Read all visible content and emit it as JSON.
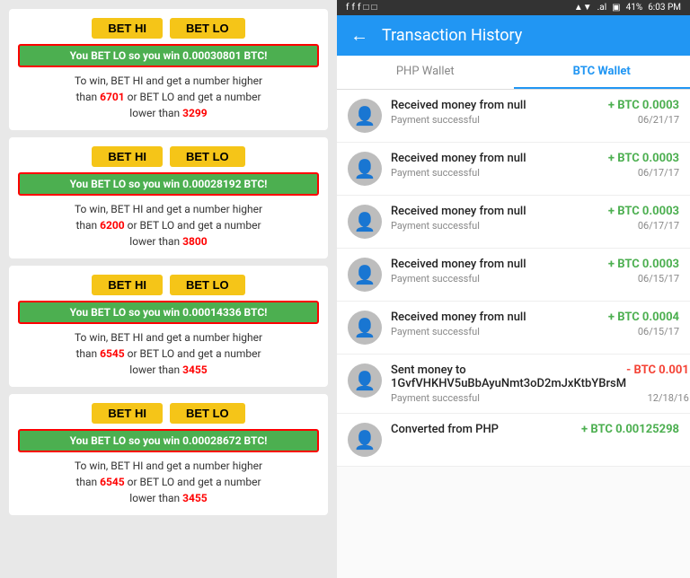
{
  "left": {
    "cards": [
      {
        "id": "card1",
        "bet_hi": "BET HI",
        "bet_lo": "BET LO",
        "win_msg": "You BET LO so you win 0.00030801 BTC!",
        "info_line1": "To win, BET HI and get a number higher",
        "info_line2": "than",
        "num_hi": "6701",
        "info_line3": "or BET LO and get a number",
        "info_line4": "lower than",
        "num_lo": "3299"
      },
      {
        "id": "card2",
        "bet_hi": "BET HI",
        "bet_lo": "BET LO",
        "win_msg": "You BET LO so you win 0.00028192 BTC!",
        "info_line1": "To win, BET HI and get a number higher",
        "info_line2": "than",
        "num_hi": "6200",
        "info_line3": "or BET LO and get a number",
        "info_line4": "lower than",
        "num_lo": "3800"
      },
      {
        "id": "card3",
        "bet_hi": "BET HI",
        "bet_lo": "BET LO",
        "win_msg": "You BET LO so you win 0.00014336 BTC!",
        "info_line1": "To win, BET HI and get a number higher",
        "info_line2": "than",
        "num_hi": "6545",
        "info_line3": "or BET LO and get a number",
        "info_line4": "lower than",
        "num_lo": "3455"
      },
      {
        "id": "card4",
        "bet_hi": "BET HI",
        "bet_lo": "BET LO",
        "win_msg": "You BET LO so you win 0.00028672 BTC!",
        "info_line1": "To win, BET HI and get a number higher",
        "info_line2": "than",
        "num_hi": "6545",
        "info_line3": "or BET LO and get a number",
        "info_line4": "lower than",
        "num_lo": "3455"
      }
    ]
  },
  "right": {
    "status_bar": {
      "left_icons": "f f f □ □",
      "signal": "▲▼ .al",
      "battery": "41%",
      "time": "6:03 PM"
    },
    "header": {
      "back_icon": "←",
      "title": "Transaction History"
    },
    "tabs": [
      {
        "label": "PHP Wallet",
        "active": false
      },
      {
        "label": "BTC Wallet",
        "active": true
      }
    ],
    "transactions": [
      {
        "avatar": "person",
        "title": "Received money from null",
        "amount": "+ BTC 0.0003",
        "amount_type": "pos",
        "status": "Payment successful",
        "date": "06/21/17"
      },
      {
        "avatar": "person",
        "title": "Received money from null",
        "amount": "+ BTC 0.0003",
        "amount_type": "pos",
        "status": "Payment successful",
        "date": "06/17/17"
      },
      {
        "avatar": "person",
        "title": "Received money from null",
        "amount": "+ BTC 0.0003",
        "amount_type": "pos",
        "status": "Payment successful",
        "date": "06/17/17"
      },
      {
        "avatar": "person",
        "title": "Received money from null",
        "amount": "+ BTC 0.0003",
        "amount_type": "pos",
        "status": "Payment successful",
        "date": "06/15/17"
      },
      {
        "avatar": "person",
        "title": "Received money from null",
        "amount": "+ BTC 0.0004",
        "amount_type": "pos",
        "status": "Payment successful",
        "date": "06/15/17"
      },
      {
        "avatar": "person",
        "title": "Sent money to 1GvfVHKHV5uBbAyuNmt3oD2mJxKtbYBrsM",
        "amount": "- BTC 0.001",
        "amount_type": "neg",
        "status": "Payment successful",
        "date": "12/18/16"
      },
      {
        "avatar": "person",
        "title": "Converted from PHP",
        "amount": "+ BTC 0.00125298",
        "amount_type": "pos",
        "status": "",
        "date": ""
      }
    ]
  }
}
